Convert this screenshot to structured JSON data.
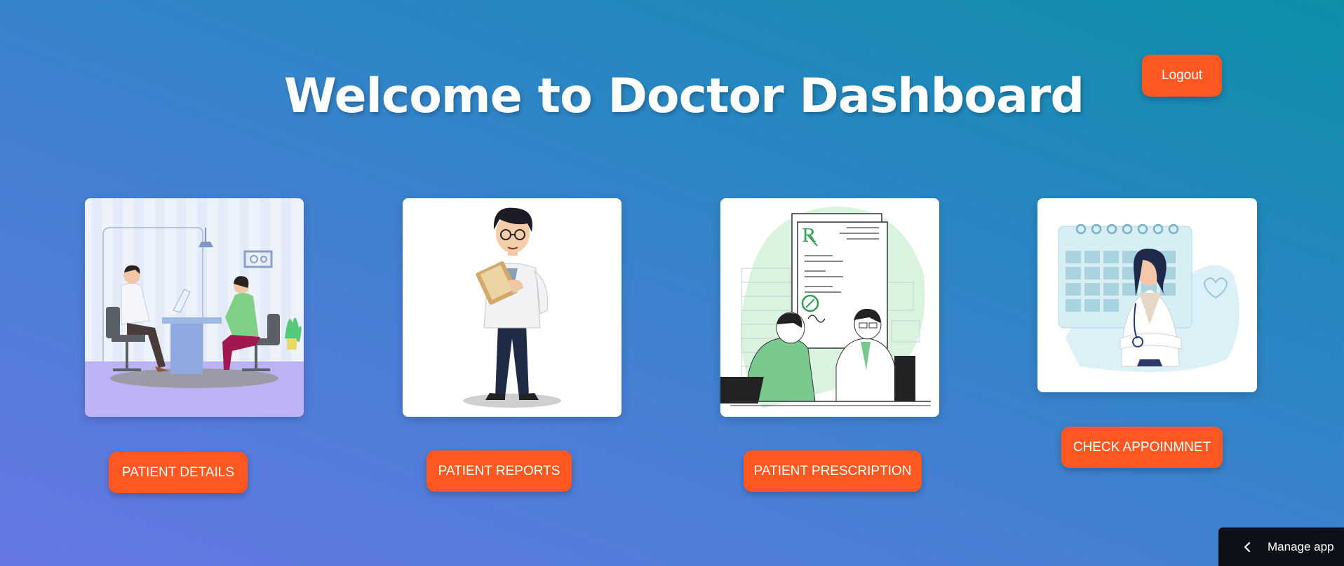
{
  "header": {
    "title": "Welcome to Doctor Dashboard",
    "logout_label": "Logout"
  },
  "cards": [
    {
      "label": "PATIENT DETAILS",
      "illustration": "doctor-patient-consultation-illustration"
    },
    {
      "label": "PATIENT REPORTS",
      "illustration": "doctor-with-clipboard-illustration"
    },
    {
      "label": "PATIENT PRESCRIPTION",
      "illustration": "prescription-illustration"
    },
    {
      "label": "CHECK APPOINMNET",
      "illustration": "doctor-calendar-illustration"
    }
  ],
  "footer": {
    "manage_label": "Manage app"
  },
  "colors": {
    "accent": "#ff5722",
    "background_start": "#6678e6",
    "background_end": "#0d8fa9",
    "manage_bar": "#0d1117"
  }
}
